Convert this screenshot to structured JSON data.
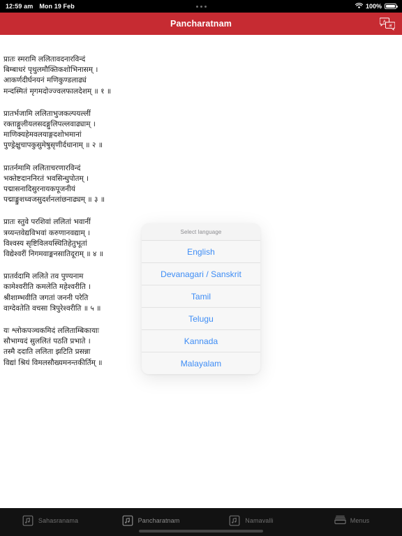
{
  "status_bar": {
    "time": "12:59 am",
    "date": "Mon 19 Feb",
    "battery_percent": "100%",
    "wifi_icon": "wifi-icon",
    "battery_icon": "battery-icon",
    "center_dots_icon": "ellipsis-icon"
  },
  "header": {
    "title": "Pancharatnam",
    "action_icon": "translate-icon",
    "background_color": "#c62b32"
  },
  "content": {
    "verses": [
      {
        "lines": [
          "प्रातः स्मरामि ललितावदनारविन्दं",
          "बिम्बाधरं पृथुलमौक्तिकशोभिनासम् ।",
          "आकर्णदीर्घनयनं मणिकुण्डलाढ्यं",
          "मन्दस्मितं मृगमदोज्ज्वलफालदेशम् ॥ १ ॥"
        ]
      },
      {
        "lines": [
          "प्रातर्भजामि ललिताभुजकल्पयल्लीं",
          "रक्ताङ्गुलीयलसदङ्गुलिपल्लवाढ्याम् ।",
          "माणिक्यहेमवलयाङ्गदशोभमानां",
          "पुण्ड्रेक्षुचापकुसुमेषुसृणीर्दधानाम् ॥ २ ॥"
        ]
      },
      {
        "lines": [
          "प्रातर्नमामि ललिताचरणारविन्दं",
          "भक्तेष्टदाननिरतं भवसिन्धुपोतम् ।",
          "पद्मासनादिसुरनायकपूजनीयं",
          "पद्माङ्कुशध्वजसुदर्शनलांछनाढ्यम् ॥ ३ ॥"
        ]
      },
      {
        "lines": [
          "प्रातः स्तुवे परशिवां ललितां भवानीं",
          "त्रय्यन्तवेद्यविभवां करुणानवद्याम् ।",
          "विश्वस्य सृष्टिविलयस्थितिहेतुभूतां",
          "विद्येश्वरीं निगमवाङ्मनसातिदूराम् ॥ ४ ॥"
        ]
      },
      {
        "lines": [
          "प्रातर्वदामि ललिते तव पुण्यनाम",
          "कामेश्वरीति कमलेति महेश्वरीति ।",
          "श्रीशाम्भवीति जगतां जननी परेति",
          "वाग्देवतेति वचसा त्रिपुरेश्वरीति ॥ ५ ॥"
        ]
      },
      {
        "lines": [
          "यः श्लोकपञ्चकमिदं ललिताम्बिकायाः",
          "सौभाग्यदं सुललितं पठति प्रभाते ।",
          "तस्मै ददाति ललिता झटिति प्रसन्ना",
          "विद्यां श्रियं विमलसौख्यमनन्तकीर्तिम् ॥"
        ]
      }
    ]
  },
  "language_sheet": {
    "title": "Select language",
    "options": [
      "English",
      "Devanagari / Sanskrit",
      "Tamil",
      "Telugu",
      "Kannada",
      "Malayalam"
    ],
    "link_color": "#3d8cf5"
  },
  "tab_bar": {
    "tabs": [
      {
        "label": "Sahasranama",
        "icon": "music-note-box-icon",
        "active": false
      },
      {
        "label": "Pancharatnam",
        "icon": "music-note-box-icon",
        "active": true
      },
      {
        "label": "Namavalli",
        "icon": "music-note-box-icon",
        "active": false
      },
      {
        "label": "Menus",
        "icon": "tray-icon",
        "active": false
      }
    ]
  }
}
